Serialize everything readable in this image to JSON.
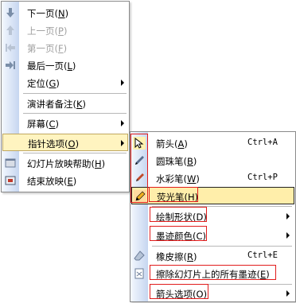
{
  "main_menu": {
    "items": [
      {
        "label": "下一页",
        "key": "N",
        "icon": "arrow-down-icon",
        "disabled": false
      },
      {
        "label": "上一页",
        "key": "P",
        "icon": "arrow-up-icon",
        "disabled": true
      },
      {
        "label": "第一页",
        "key": "F",
        "icon": "first-page-icon",
        "disabled": true
      },
      {
        "label": "最后一页",
        "key": "L",
        "icon": "last-page-icon",
        "disabled": false
      },
      {
        "label": "定位",
        "key": "G",
        "icon": "",
        "disabled": false,
        "submenu": true
      },
      {
        "label": "演讲者备注",
        "key": "K",
        "icon": "",
        "disabled": false
      },
      {
        "label": "屏幕",
        "key": "C",
        "icon": "",
        "disabled": false,
        "submenu": true
      },
      {
        "label": "指针选项",
        "key": "O",
        "icon": "",
        "disabled": false,
        "submenu": true
      },
      {
        "label": "幻灯片放映帮助",
        "key": "H",
        "icon": "help-icon",
        "disabled": false
      },
      {
        "label": "结束放映",
        "key": "E",
        "icon": "end-show-icon",
        "disabled": false
      }
    ]
  },
  "pointer_menu": {
    "items": [
      {
        "label": "箭头",
        "key": "A",
        "shortcut": "Ctrl+A"
      },
      {
        "label": "圆珠笔",
        "key": "B",
        "shortcut": ""
      },
      {
        "label": "水彩笔",
        "key": "W",
        "shortcut": "Ctrl+P"
      },
      {
        "label": "荧光笔",
        "key": "H",
        "shortcut": ""
      },
      {
        "label": "绘制形状",
        "key": "D",
        "shortcut": ""
      },
      {
        "label": "墨迹颜色",
        "key": "C",
        "shortcut": ""
      },
      {
        "label": "橡皮擦",
        "key": "R",
        "shortcut": "Ctrl+E"
      },
      {
        "label": "擦除幻灯片上的所有墨迹",
        "key": "E",
        "shortcut": ""
      },
      {
        "label": "箭头选项",
        "key": "O",
        "shortcut": ""
      }
    ]
  },
  "colors": {
    "highlight": "#ffeeaa",
    "annotation_red": "#e11c1c",
    "gutter": "#c6d6f0"
  }
}
